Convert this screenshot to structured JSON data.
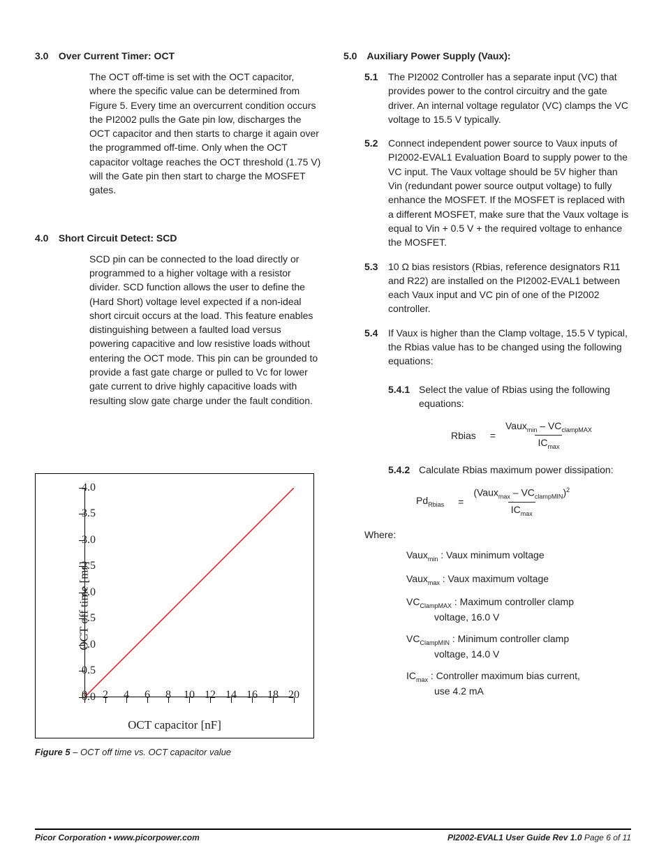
{
  "left": {
    "s3": {
      "num": "3.0",
      "title": "Over Current Timer: OCT",
      "body": "The OCT off-time is set with the OCT capacitor, where the specific value can be determined from Figure 5. Every time an overcurrent condition occurs the PI2002 pulls the Gate pin low, discharges the OCT capacitor and then starts to charge it again over the programmed off-time. Only when the OCT capacitor voltage reaches the OCT threshold (1.75 V) will the Gate pin then start to charge the MOSFET gates."
    },
    "s4": {
      "num": "4.0",
      "title": "Short Circuit Detect: SCD",
      "body": "SCD pin can be connected to the load directly or programmed to a higher voltage with a resistor divider. SCD function allows the user to define the (Hard Short) voltage level expected if a non-ideal short circuit occurs at the load. This feature enables distinguishing between a faulted load versus powering capacitive and low resistive loads without entering the OCT mode. This pin can be grounded to provide a fast gate charge or pulled to Vc for lower gate current to drive highly capacitive loads with resulting slow gate charge under the fault condition."
    },
    "figure": {
      "caption_lead": "Figure 5",
      "caption_rest": " – OCT off time vs. OCT capacitor value"
    }
  },
  "right": {
    "s5": {
      "num": "5.0",
      "title": "Auxiliary Power Supply (Vaux):",
      "items": {
        "i1": {
          "n": "5.1",
          "t": "The PI2002 Controller has a separate input (VC) that provides power to the control circuitry and the gate driver. An internal voltage regulator (VC) clamps the VC voltage to 15.5 V typically."
        },
        "i2": {
          "n": "5.2",
          "t": "Connect independent power source to Vaux inputs of PI2002-EVAL1 Evaluation Board to supply power to the VC input. The Vaux voltage should be 5V higher than Vin (redundant power source output voltage) to fully enhance the MOSFET. If the MOSFET is replaced with a different MOSFET, make sure that the Vaux voltage is equal to Vin + 0.5 V + the required voltage to enhance the MOSFET."
        },
        "i3": {
          "n": "5.3",
          "t": "10 Ω bias resistors (Rbias, reference designators R11 and R22) are installed on the PI2002-EVAL1 between each Vaux input and VC pin of one of the PI2002 controller."
        },
        "i4": {
          "n": "5.4",
          "t": "If Vaux is higher than the Clamp voltage, 15.5 V typical, the Rbias value has to be changed using the following equations:"
        }
      },
      "subitems": {
        "s541": {
          "n": "5.4.1",
          "t": "Select the value of Rbias using the following equations:"
        },
        "s542": {
          "n": "5.4.2",
          "t": "Calculate Rbias maximum power dissipation:"
        }
      },
      "eq1": {
        "lhs": "Rbias",
        "num_a": "Vaux",
        "num_a_sub": "min",
        "num_minus": " – ",
        "num_b": "VC",
        "num_b_sub": "clampMAX",
        "den": "IC",
        "den_sub": "max"
      },
      "eq2": {
        "lhs": "Pd",
        "lhs_sub": "Rbias",
        "num_open": "(",
        "num_a": "Vaux",
        "num_a_sub": "max",
        "num_minus": " – ",
        "num_b": "VC",
        "num_b_sub": "clampMIN",
        "num_close": ")",
        "num_sq": "2",
        "den": "IC",
        "den_sub": "max"
      },
      "where": {
        "label": "Where:",
        "d1": {
          "sym": "Vaux",
          "sub": "min",
          "txt": " : Vaux minimum voltage"
        },
        "d2": {
          "sym": "Vaux",
          "sub": "max",
          "txt": " : Vaux maximum voltage"
        },
        "d3": {
          "sym": "VC",
          "sub": "ClampMAX",
          "txt": " : Maximum controller clamp",
          "cont": "voltage, 16.0 V"
        },
        "d4": {
          "sym": "VC",
          "sub": "ClampMIN",
          "txt": " : Minimum controller clamp",
          "cont": "voltage, 14.0 V"
        },
        "d5": {
          "sym": "IC",
          "sub": "max",
          "txt": " : Controller maximum bias current,",
          "cont": "use 4.2 mA"
        }
      }
    }
  },
  "footer": {
    "left": "Picor Corporation • www.picorpower.com",
    "right_a": "PI2002-EVAL1 User Guide  Rev 1.0",
    "right_b": "  Page 6 of 11"
  },
  "chart_data": {
    "type": "line",
    "title": "",
    "xlabel": "OCT capacitor [nF]",
    "ylabel": "OCT off time [ms]",
    "xlim": [
      0,
      20
    ],
    "ylim": [
      0,
      4.0
    ],
    "xticks": [
      0,
      2,
      4,
      6,
      8,
      10,
      12,
      14,
      16,
      18,
      20
    ],
    "yticks": [
      0.0,
      0.5,
      1.0,
      1.5,
      2.0,
      2.5,
      3.0,
      3.5,
      4.0
    ],
    "series": [
      {
        "name": "OCT off time",
        "color": "#e11",
        "x": [
          0,
          2,
          4,
          6,
          8,
          10,
          12,
          14,
          16,
          18,
          20
        ],
        "values": [
          0.0,
          0.4,
          0.8,
          1.2,
          1.6,
          2.0,
          2.4,
          2.8,
          3.2,
          3.6,
          4.0
        ]
      }
    ]
  }
}
